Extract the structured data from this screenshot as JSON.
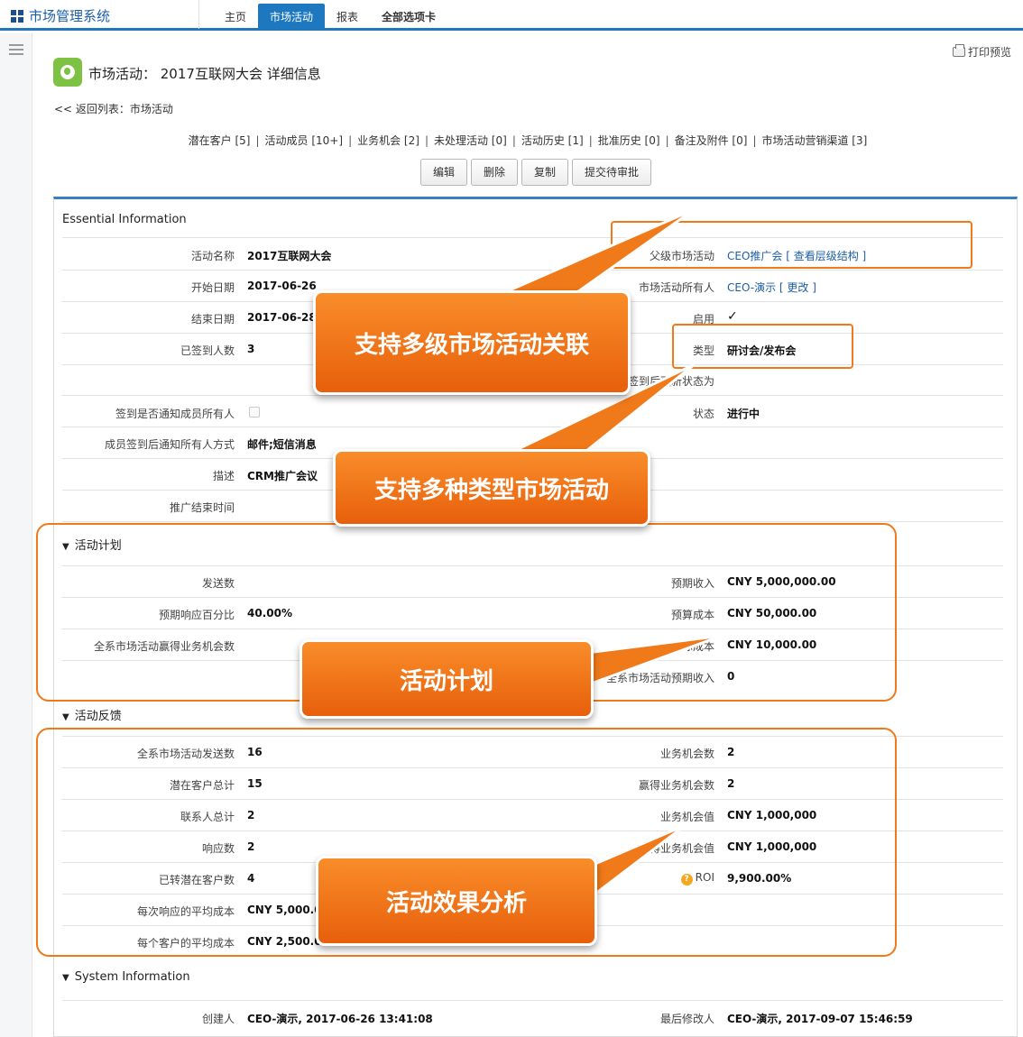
{
  "topbar": {
    "app_title": "市场管理系统",
    "tabs": [
      {
        "label": "主页"
      },
      {
        "label": "市场活动"
      },
      {
        "label": "报表"
      },
      {
        "label": "全部选项卡"
      }
    ]
  },
  "header": {
    "print_label": "打印预览",
    "page_title": "市场活动： 2017互联网大会 详细信息",
    "back_link": "<< 返回列表：市场活动"
  },
  "related_links": [
    "潜在客户 [5]",
    "活动成员 [10+]",
    "业务机会 [2]",
    "未处理活动 [0]",
    "活动历史 [1]",
    "批准历史 [0]",
    "备注及附件 [0]",
    "市场活动营销渠道 [3]"
  ],
  "buttons": {
    "edit": "编辑",
    "delete": "删除",
    "copy": "复制",
    "submit": "提交待审批"
  },
  "essential": {
    "title": "Essential Information",
    "name_label": "活动名称",
    "name_value": "2017互联网大会",
    "start_label": "开始日期",
    "start_value": "2017-06-26",
    "end_label": "结束日期",
    "end_value": "2017-06-28",
    "signed_label": "已签到人数",
    "signed_value": "3",
    "notify_label": "签到是否通知成员所有人",
    "notify_method_label": "成员签到后通知所有人方式",
    "notify_method_value": "邮件;短信消息",
    "desc_label": "描述",
    "desc_value": "CRM推广会议",
    "promo_end_label": "推广结束时间",
    "parent_label": "父级市场活动",
    "parent_value": "CEO推广会 [ 查看层级结构 ]",
    "owner_label": "市场活动所有人",
    "owner_value": "CEO-演示 [ 更改 ]",
    "enabled_label": "启用",
    "enabled_value": "✓",
    "type_label": "类型",
    "type_value": "研讨会/发布会",
    "after_sign_label": "签到后更新状态为",
    "status_label": "状态",
    "status_value": "进行中"
  },
  "plan": {
    "title": "活动计划",
    "sent_label": "发送数",
    "response_pct_label": "预期响应百分比",
    "response_pct_value": "40.00%",
    "won_opps_label": "全系市场活动赢得业务机会数",
    "expected_rev_label": "预期收入",
    "expected_rev_value": "CNY 5,000,000.00",
    "budget_label": "预算成本",
    "budget_value": "CNY 50,000.00",
    "actual_label": "实际成本",
    "actual_value": "CNY 10,000.00",
    "all_expected_label": "全系市场活动预期收入",
    "all_expected_value": "0"
  },
  "feedback": {
    "title": "活动反馈",
    "all_sent_label": "全系市场活动发送数",
    "all_sent_value": "16",
    "leads_label": "潜在客户总计",
    "leads_value": "15",
    "contacts_label": "联系人总计",
    "contacts_value": "2",
    "responses_label": "响应数",
    "responses_value": "2",
    "converted_label": "已转潜在客户数",
    "converted_value": "4",
    "cost_per_resp_label": "每次响应的平均成本",
    "cost_per_resp_value": "CNY 5,000.00",
    "cost_per_cust_label": "每个客户的平均成本",
    "cost_per_cust_value": "CNY 2,500.00",
    "opps_label": "业务机会数",
    "opps_value": "2",
    "won_label": "赢得业务机会数",
    "won_value": "2",
    "opp_value_label": "业务机会值",
    "opp_value_value": "CNY 1,000,000",
    "won_value_label": "赢得业务机会值",
    "won_value_value": "CNY 1,000,000",
    "roi_label": "ROI",
    "roi_value": "9,900.00%"
  },
  "system": {
    "title": "System Information",
    "created_label": "创建人",
    "created_value": "CEO-演示, 2017-06-26 13:41:08",
    "modified_label": "最后修改人",
    "modified_value": "CEO-演示, 2017-09-07 15:46:59"
  },
  "callouts": {
    "multi_level": "支持多级市场活动关联",
    "multi_type": "支持多种类型市场活动",
    "plan": "活动计划",
    "effect": "活动效果分析"
  },
  "colors": {
    "brand_blue": "#1d78c0",
    "callout_orange": "#f07a1a",
    "page_icon_green": "#7dc242"
  }
}
